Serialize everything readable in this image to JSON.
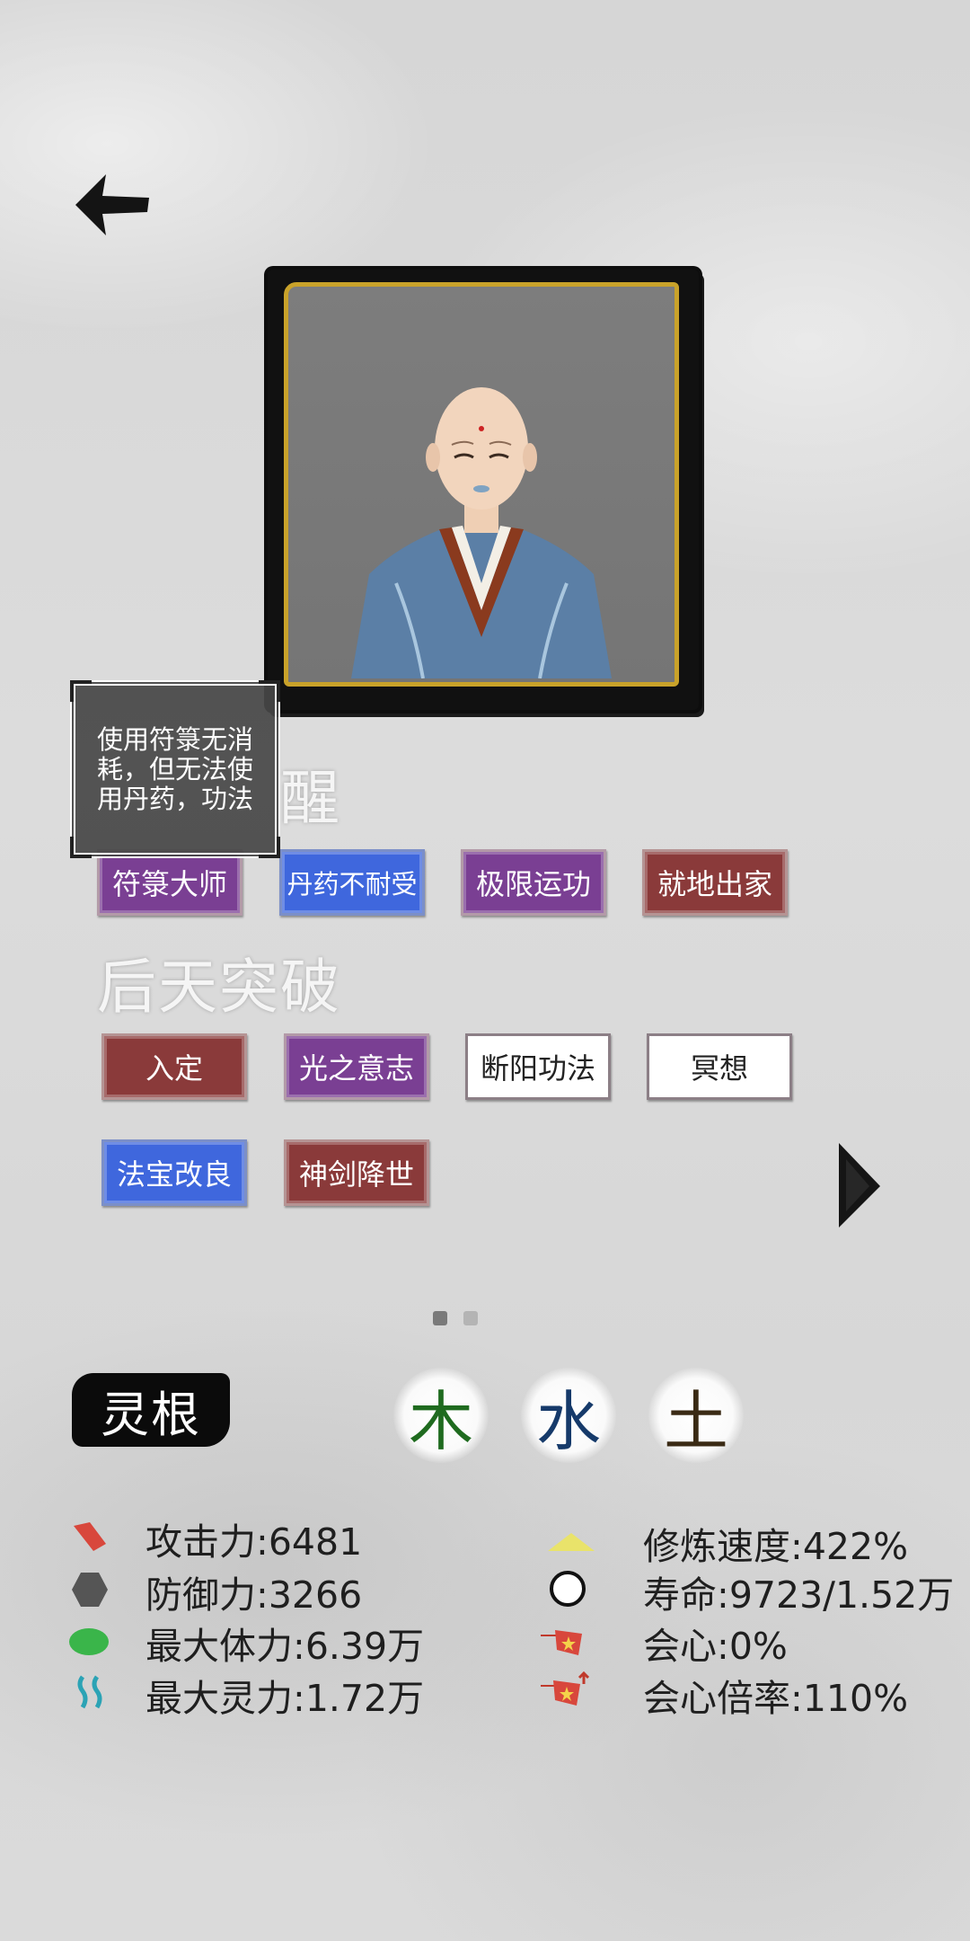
{
  "tooltip": {
    "text": "使用符箓无消耗，但无法使用丹药，功法"
  },
  "section1": {
    "title_fragment": "醒"
  },
  "traits": [
    {
      "label": "符箓大师",
      "color": "purple"
    },
    {
      "label": "丹药不耐受",
      "color": "blue"
    },
    {
      "label": "极限运功",
      "color": "purple"
    },
    {
      "label": "就地出家",
      "color": "red"
    }
  ],
  "section2": {
    "title": "后天突破"
  },
  "skills": [
    {
      "label": "入定",
      "color": "red"
    },
    {
      "label": "光之意志",
      "color": "purple"
    },
    {
      "label": "断阳功法",
      "color": "white"
    },
    {
      "label": "冥想",
      "color": "white"
    },
    {
      "label": "法宝改良",
      "color": "blue"
    },
    {
      "label": "神剑降世",
      "color": "red"
    }
  ],
  "pagination": {
    "total": 2,
    "active": 1
  },
  "linggen": {
    "label": "灵根",
    "elements": [
      {
        "char": "木",
        "color": "#1f6b1f"
      },
      {
        "char": "水",
        "color": "#163a6a"
      },
      {
        "char": "土",
        "color": "#3a2a14"
      }
    ]
  },
  "stats": {
    "attack": "攻击力:6481",
    "defense": "防御力:3266",
    "max_hp": "最大体力:6.39万",
    "max_mp": "最大灵力:1.72万",
    "cultivation_speed": "修炼速度:422%",
    "lifespan": "寿命:9723/1.52万",
    "crit": "会心:0%",
    "crit_multiplier": "会心倍率:110%"
  },
  "icons": {
    "back": "back-arrow-icon",
    "next": "next-arrow-icon"
  }
}
